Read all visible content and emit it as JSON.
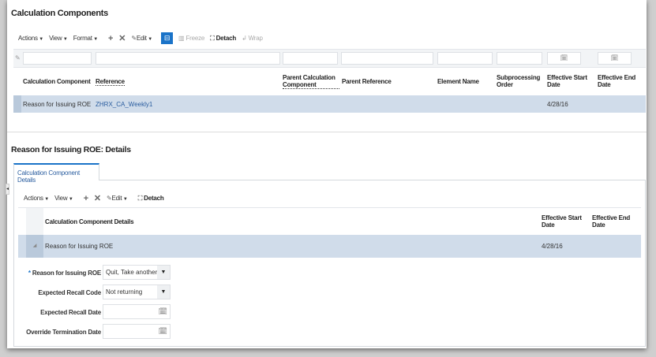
{
  "top": {
    "title": "Calculation Components",
    "toolbar": {
      "actions": "Actions",
      "view": "View",
      "format": "Format",
      "edit": "Edit",
      "freeze": "Freeze",
      "detach": "Detach",
      "wrap": "Wrap"
    },
    "columns": [
      "Calculation Component",
      "Reference",
      "Parent Calculation Component",
      "Parent Reference",
      "Element Name",
      "Subprocessing Order",
      "Effective Start Date",
      "Effective End Date"
    ],
    "rows": [
      {
        "calc_component": "Reason for Issuing ROE",
        "reference": "ZHRX_CA_Weekly1",
        "parent_calc": "",
        "parent_ref": "",
        "element": "",
        "subproc": "",
        "start": "4/28/16",
        "end": ""
      }
    ]
  },
  "details": {
    "title": "Reason for Issuing ROE: Details",
    "tab": "Calculation Component Details",
    "toolbar": {
      "actions": "Actions",
      "view": "View",
      "edit": "Edit",
      "detach": "Detach"
    },
    "columns": [
      "Calculation Component Details",
      "Effective Start Date",
      "Effective End Date"
    ],
    "rows": [
      {
        "detail": "Reason for Issuing ROE",
        "start": "4/28/16",
        "end": ""
      }
    ],
    "form": {
      "reason_label": "Reason for Issuing ROE",
      "reason_value": "Quit, Take another job",
      "required_mark": "*",
      "recall_code_label": "Expected Recall Code",
      "recall_code_value": "Not returning",
      "recall_date_label": "Expected Recall Date",
      "recall_date_value": "",
      "override_label": "Override Termination Date",
      "override_value": ""
    }
  },
  "colors": {
    "selected_row": "#d0dcea",
    "link": "#2a5d9f",
    "accent": "#1a73c8"
  }
}
